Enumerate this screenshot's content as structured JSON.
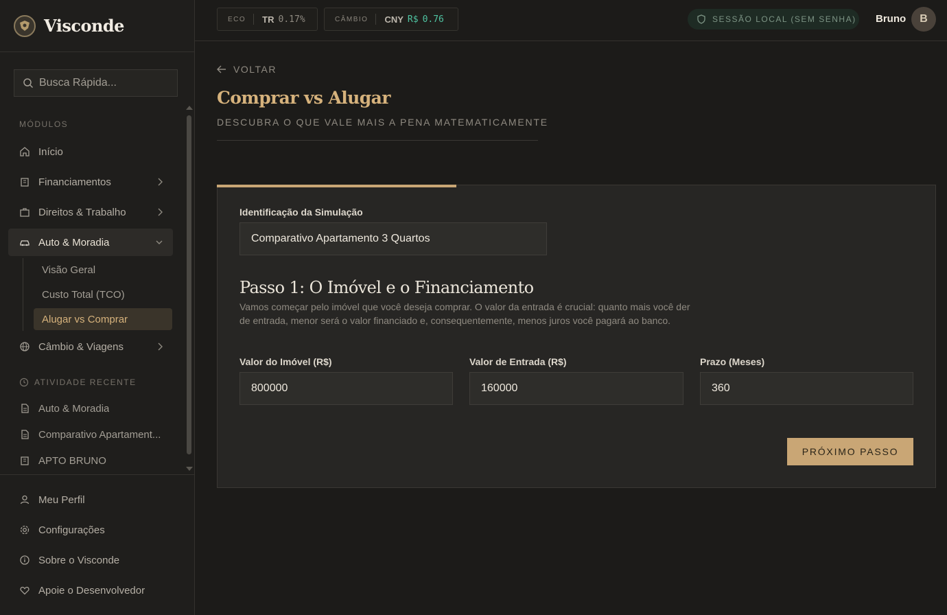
{
  "brand": {
    "name": "Visconde"
  },
  "search": {
    "placeholder": "Busca Rápida..."
  },
  "sidebar": {
    "modules_label": "MÓDULOS",
    "items": [
      {
        "label": "Início",
        "icon": "home-icon"
      },
      {
        "label": "Financiamentos",
        "icon": "building-icon"
      },
      {
        "label": "Direitos & Trabalho",
        "icon": "briefcase-icon"
      },
      {
        "label": "Auto & Moradia",
        "icon": "car-icon"
      },
      {
        "label": "Câmbio & Viagens",
        "icon": "globe-icon"
      }
    ],
    "sub_items": [
      {
        "label": "Visão Geral"
      },
      {
        "label": "Custo Total (TCO)"
      },
      {
        "label": "Alugar vs Comprar"
      }
    ],
    "recent_label": "ATIVIDADE RECENTE",
    "recent": [
      {
        "label": "Auto & Moradia",
        "icon": "document-icon"
      },
      {
        "label": "Comparativo Apartament...",
        "icon": "document-icon"
      },
      {
        "label": "APTO BRUNO",
        "icon": "building-icon"
      }
    ],
    "bottom": [
      {
        "label": "Meu Perfil",
        "icon": "user-icon"
      },
      {
        "label": "Configurações",
        "icon": "gear-icon"
      },
      {
        "label": "Sobre o Visconde",
        "icon": "info-icon"
      },
      {
        "label": "Apoie o Desenvolvedor",
        "icon": "heart-icon"
      }
    ]
  },
  "header": {
    "tickers": [
      {
        "label": "ECO",
        "symbol": "TR",
        "value": "0.17%",
        "value_color": "#8f8a81"
      },
      {
        "label": "CÂMBIO",
        "symbol": "CNY",
        "prefix": "R$",
        "value": "0.76",
        "value_color": "#4fc3a1"
      }
    ],
    "session": "SESSÃO LOCAL (SEM SENHA)",
    "user_name": "Bruno",
    "avatar_initial": "B"
  },
  "main": {
    "back_label": "VOLTAR",
    "title": "Comprar vs Alugar",
    "subtitle": "DESCUBRA O QUE VALE MAIS A PENA MATEMATICAMENTE",
    "progress_fraction": 0.333,
    "sim_label": "Identificação da Simulação",
    "sim_value": "Comparativo Apartamento 3 Quartos",
    "step_title": "Passo 1: O Imóvel e o Financiamento",
    "step_desc": "Vamos começar pelo imóvel que você deseja comprar. O valor da entrada é crucial: quanto mais você der de entrada, menor será o valor financiado e, consequentemente, menos juros você pagará ao banco.",
    "fields": [
      {
        "label": "Valor do Imóvel (R$)",
        "value": "800000"
      },
      {
        "label": "Valor de Entrada (R$)",
        "value": "160000"
      },
      {
        "label": "Prazo (Meses)",
        "value": "360"
      }
    ],
    "next_label": "PRÓXIMO PASSO"
  },
  "colors": {
    "accent": "#c9a675",
    "background": "#1c1b19",
    "card": "#272624",
    "positive": "#4fc3a1"
  }
}
